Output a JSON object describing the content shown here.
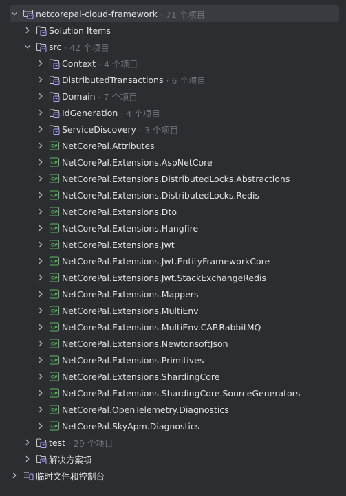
{
  "colors": {
    "background": "#2b2d30",
    "selection": "#393b40",
    "text": "#dfe1e5",
    "muted": "#6f737a",
    "csharp_green": "#5fb865",
    "folder_accent": "#a9a9ff"
  },
  "tree": [
    {
      "label": "netcorepal-cloud-framework",
      "count": "71 个项目",
      "icon": "solution-icon",
      "depth": 0,
      "expanded": true,
      "selected": true
    },
    {
      "label": "Solution Items",
      "count": "",
      "icon": "solution-folder-icon",
      "depth": 1,
      "expanded": false
    },
    {
      "label": "src",
      "count": "42 个项目",
      "icon": "solution-folder-icon",
      "depth": 1,
      "expanded": true
    },
    {
      "label": "Context",
      "count": "4 个项目",
      "icon": "solution-folder-icon",
      "depth": 2,
      "expanded": false
    },
    {
      "label": "DistributedTransactions",
      "count": "6 个项目",
      "icon": "solution-folder-icon",
      "depth": 2,
      "expanded": false
    },
    {
      "label": "Domain",
      "count": "7 个项目",
      "icon": "solution-folder-icon",
      "depth": 2,
      "expanded": false
    },
    {
      "label": "IdGeneration",
      "count": "4 个项目",
      "icon": "solution-folder-icon",
      "depth": 2,
      "expanded": false
    },
    {
      "label": "ServiceDiscovery",
      "count": "3 个项目",
      "icon": "solution-folder-icon",
      "depth": 2,
      "expanded": false
    },
    {
      "label": "NetCorePal.Attributes",
      "count": "",
      "icon": "csharp-project-icon",
      "depth": 2,
      "expanded": false
    },
    {
      "label": "NetCorePal.Extensions.AspNetCore",
      "count": "",
      "icon": "csharp-project-icon",
      "depth": 2,
      "expanded": false
    },
    {
      "label": "NetCorePal.Extensions.DistributedLocks.Abstractions",
      "count": "",
      "icon": "csharp-project-icon",
      "depth": 2,
      "expanded": false
    },
    {
      "label": "NetCorePal.Extensions.DistributedLocks.Redis",
      "count": "",
      "icon": "csharp-project-icon",
      "depth": 2,
      "expanded": false
    },
    {
      "label": "NetCorePal.Extensions.Dto",
      "count": "",
      "icon": "csharp-project-icon",
      "depth": 2,
      "expanded": false
    },
    {
      "label": "NetCorePal.Extensions.Hangfire",
      "count": "",
      "icon": "csharp-project-icon",
      "depth": 2,
      "expanded": false
    },
    {
      "label": "NetCorePal.Extensions.Jwt",
      "count": "",
      "icon": "csharp-project-icon",
      "depth": 2,
      "expanded": false
    },
    {
      "label": "NetCorePal.Extensions.Jwt.EntityFrameworkCore",
      "count": "",
      "icon": "csharp-project-icon",
      "depth": 2,
      "expanded": false
    },
    {
      "label": "NetCorePal.Extensions.Jwt.StackExchangeRedis",
      "count": "",
      "icon": "csharp-project-icon",
      "depth": 2,
      "expanded": false
    },
    {
      "label": "NetCorePal.Extensions.Mappers",
      "count": "",
      "icon": "csharp-project-icon",
      "depth": 2,
      "expanded": false
    },
    {
      "label": "NetCorePal.Extensions.MultiEnv",
      "count": "",
      "icon": "csharp-project-icon",
      "depth": 2,
      "expanded": false
    },
    {
      "label": "NetCorePal.Extensions.MultiEnv.CAP.RabbitMQ",
      "count": "",
      "icon": "csharp-project-icon",
      "depth": 2,
      "expanded": false
    },
    {
      "label": "NetCorePal.Extensions.NewtonsoftJson",
      "count": "",
      "icon": "csharp-project-icon",
      "depth": 2,
      "expanded": false
    },
    {
      "label": "NetCorePal.Extensions.Primitives",
      "count": "",
      "icon": "csharp-project-icon",
      "depth": 2,
      "expanded": false
    },
    {
      "label": "NetCorePal.Extensions.ShardingCore",
      "count": "",
      "icon": "csharp-project-icon",
      "depth": 2,
      "expanded": false
    },
    {
      "label": "NetCorePal.Extensions.ShardingCore.SourceGenerators",
      "count": "",
      "icon": "csharp-project-icon",
      "depth": 2,
      "expanded": false
    },
    {
      "label": "NetCorePal.OpenTelemetry.Diagnostics",
      "count": "",
      "icon": "csharp-project-icon",
      "depth": 2,
      "expanded": false
    },
    {
      "label": "NetCorePal.SkyApm.Diagnostics",
      "count": "",
      "icon": "csharp-project-icon",
      "depth": 2,
      "expanded": false
    },
    {
      "label": "test",
      "count": "29 个项目",
      "icon": "solution-folder-icon",
      "depth": 1,
      "expanded": false
    },
    {
      "label": "解决方案项",
      "count": "",
      "icon": "solution-folder-icon",
      "depth": 1,
      "expanded": false
    },
    {
      "label": "临时文件和控制台",
      "count": "",
      "icon": "scratches-icon",
      "depth": 0,
      "expanded": false
    }
  ]
}
